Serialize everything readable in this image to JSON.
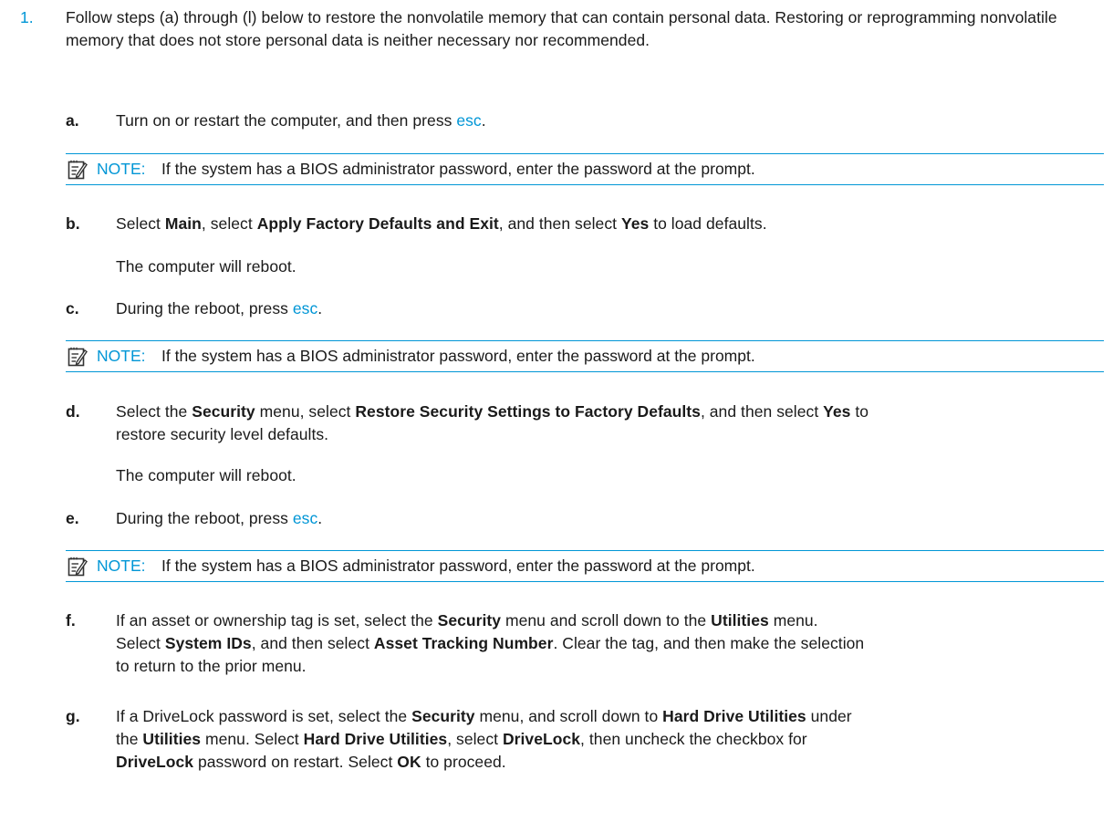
{
  "step1": {
    "number": "1.",
    "text": "Follow steps (a) through (l) below to restore the nonvolatile memory that can contain personal data. Restoring or reprogramming nonvolatile memory that does not store personal data is neither necessary nor recommended."
  },
  "note": {
    "label": "NOTE:",
    "text": "If the system has a BIOS administrator password, enter the password at the prompt.",
    "icon": "note-pencil-icon"
  },
  "substeps": {
    "a": {
      "letter": "a.",
      "t1": "Turn on or restart the computer, and then press ",
      "key": "esc",
      "t2": "."
    },
    "b": {
      "letter": "b.",
      "t1": "Select ",
      "b1": "Main",
      "t2": ", select ",
      "b2": "Apply Factory Defaults and Exit",
      "t3": ", and then select ",
      "b3": "Yes",
      "t4": " to load defaults.",
      "followup": "The computer will reboot."
    },
    "c": {
      "letter": "c.",
      "t1": "During the reboot, press ",
      "key": "esc",
      "t2": "."
    },
    "d": {
      "letter": "d.",
      "t1": "Select the ",
      "b1": "Security",
      "t2": " menu, select ",
      "b2": "Restore Security Settings to Factory Defaults",
      "t3": ", and then select ",
      "b3": "Yes",
      "t4": " to",
      "line2": "restore security level defaults.",
      "followup": "The computer will reboot."
    },
    "e": {
      "letter": "e.",
      "t1": "During the reboot, press ",
      "key": "esc",
      "t2": "."
    },
    "f": {
      "letter": "f.",
      "l1_t1": "If an asset or ownership tag is set, select the ",
      "l1_b1": "Security",
      "l1_t2": " menu and scroll down to the ",
      "l1_b2": "Utilities",
      "l1_t3": " menu.",
      "l2_t1": "Select ",
      "l2_b1": "System IDs",
      "l2_t2": ", and then select ",
      "l2_b2": "Asset Tracking Number",
      "l2_t3": ". Clear the tag, and then make the selection",
      "l3": "to return to the prior menu."
    },
    "g": {
      "letter": "g.",
      "l1_t1": "If a DriveLock password is set, select the ",
      "l1_b1": "Security",
      "l1_t2": " menu, and scroll down to ",
      "l1_b2": "Hard Drive Utilities",
      "l1_t3": " under",
      "l2_t1": "the ",
      "l2_b1": "Utilities",
      "l2_t2": " menu. Select ",
      "l2_b2": "Hard Drive Utilities",
      "l2_t3": ", select ",
      "l2_b3": "DriveLock",
      "l2_t4": ", then uncheck the checkbox for",
      "l3_b1": "DriveLock",
      "l3_t1": " password on restart. Select ",
      "l3_b2": "OK",
      "l3_t2": " to proceed."
    }
  },
  "colors": {
    "accent": "#0096d6",
    "text": "#1a1a1a"
  }
}
